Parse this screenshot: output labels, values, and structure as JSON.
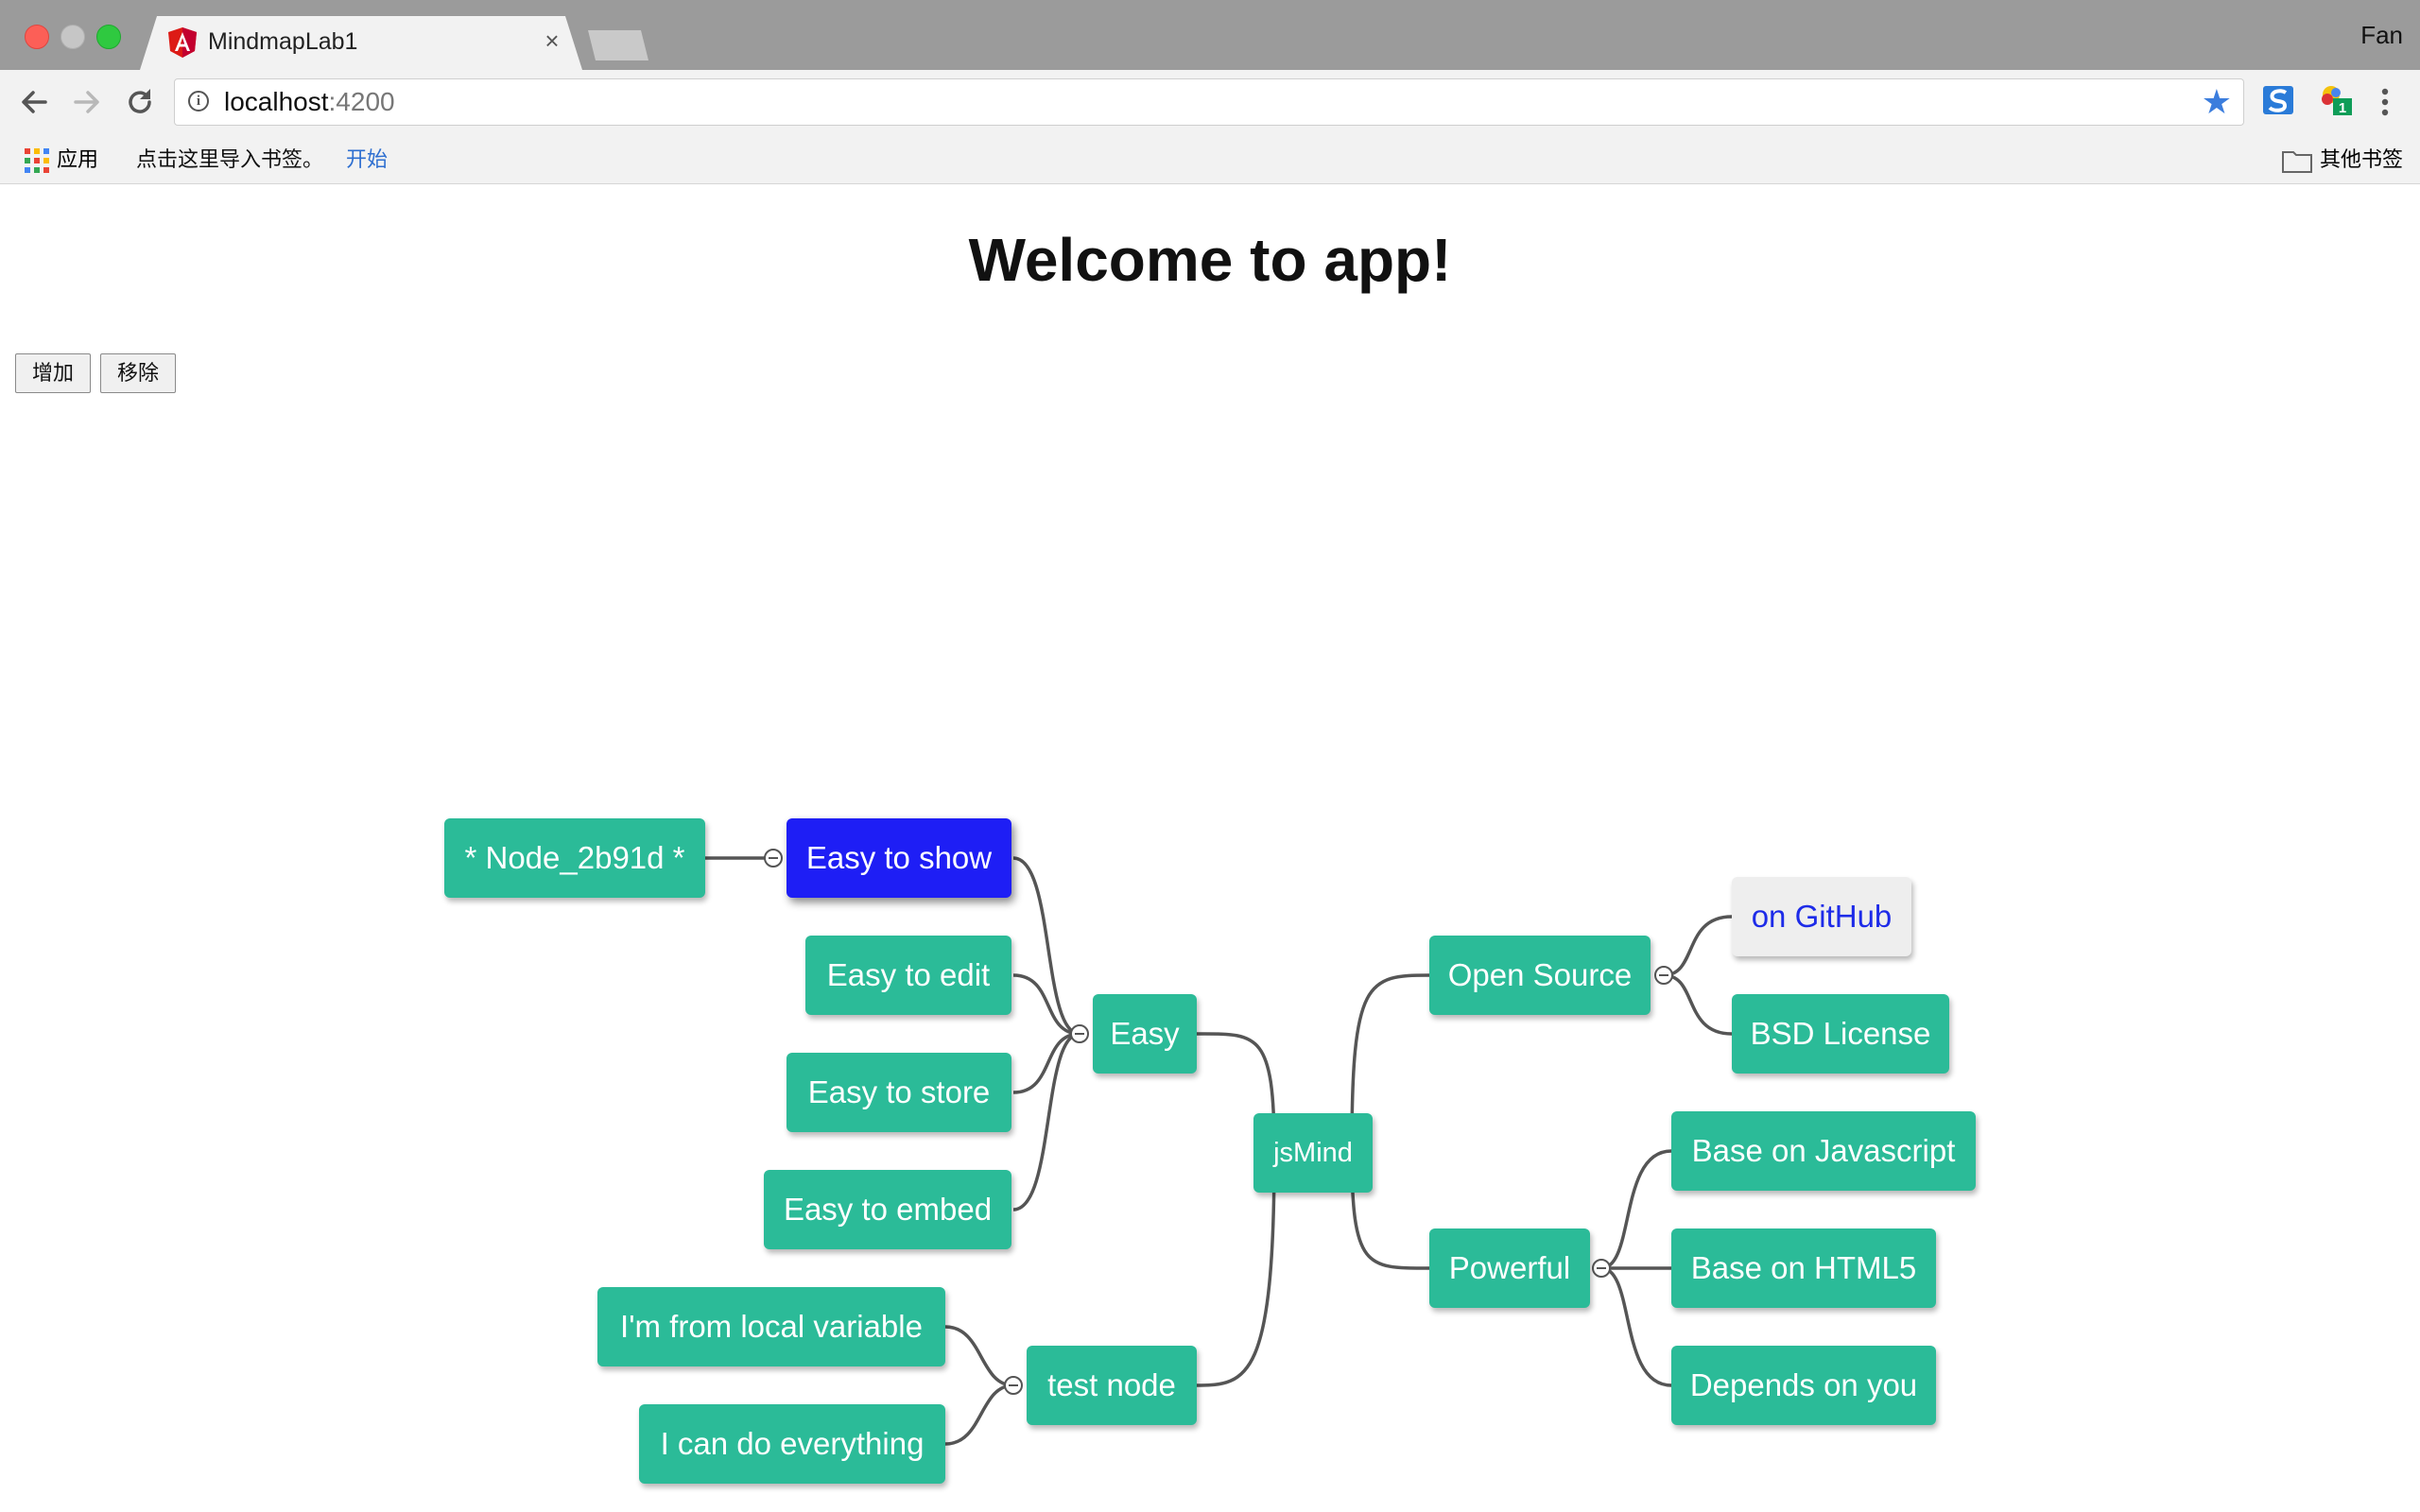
{
  "browser": {
    "tab_title": "MindmapLab1",
    "tab_close": "×",
    "profile_name": "Fan",
    "url_host": "localhost",
    "url_port": ":4200",
    "bookmarks": {
      "apps": "应用",
      "import": "点击这里导入书签。",
      "start": "开始",
      "other": "其他书签"
    },
    "extension_badge": "1"
  },
  "page": {
    "title": "Welcome to app!",
    "add_button": "增加",
    "remove_button": "移除"
  },
  "mindmap": {
    "nodes": {
      "root": "jsMind",
      "easy": "Easy",
      "easy_show": "Easy to show",
      "easy_edit": "Easy to edit",
      "easy_store": "Easy to store",
      "easy_embed": "Easy to embed",
      "new_node": "* Node_2b91d *",
      "open_source": "Open Source",
      "github": "on GitHub",
      "bsd": "BSD License",
      "powerful": "Powerful",
      "base_js": "Base on Javascript",
      "base_html5": "Base on HTML5",
      "depends": "Depends on you",
      "test_node": "test node",
      "local_var": "I'm from local variable",
      "can_do": "I can do everything"
    },
    "selected_node": "Easy to show"
  },
  "colors": {
    "node": "#2bbb98",
    "selected_node": "#1e1ef5",
    "link_text": "#1d2be8",
    "edge": "#555555"
  }
}
